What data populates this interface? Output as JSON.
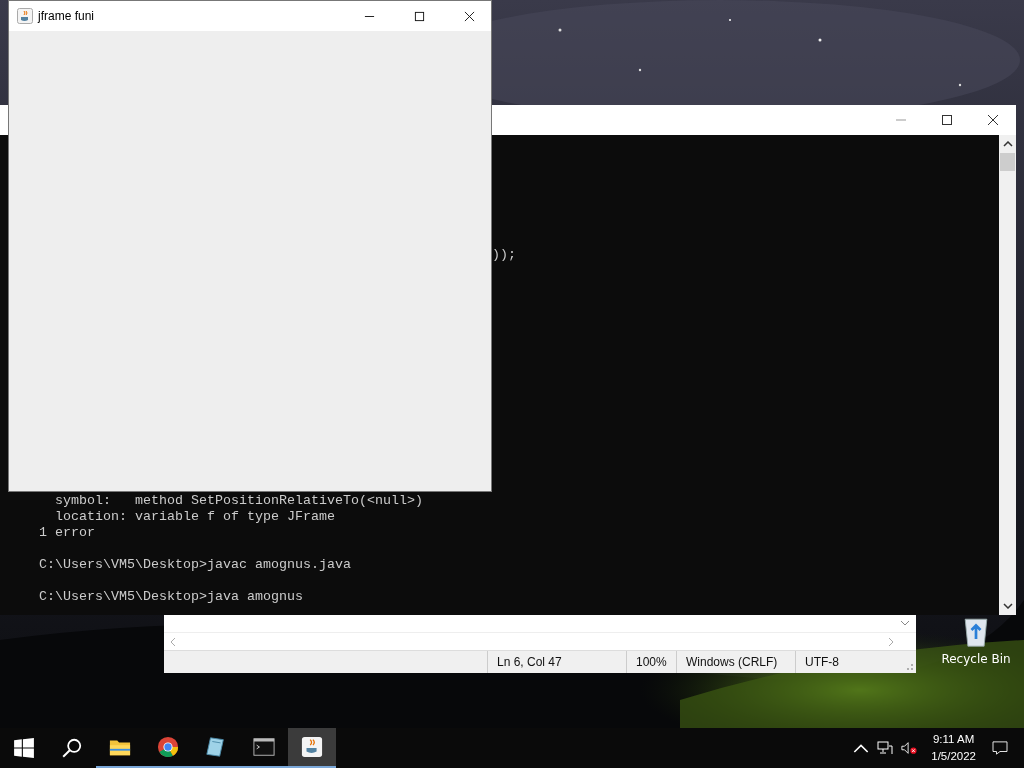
{
  "desktop": {
    "icons": [
      {
        "label": "Recycle Bin"
      }
    ]
  },
  "notepad": {
    "status_bar": [
      "Ln 6, Col 47",
      "100%",
      "Windows (CRLF)",
      "UTF-8"
    ]
  },
  "console": {
    "fragment": "));",
    "groups": [
      {
        "lines": [
          "  symbol:   method SetPositionRelativeTo(<null>)",
          "  location: variable f of type JFrame",
          "1 error"
        ]
      },
      {
        "lines": [
          "C:\\Users\\VM5\\Desktop>javac amognus.java"
        ]
      },
      {
        "lines": [
          "C:\\Users\\VM5\\Desktop>java amognus"
        ]
      }
    ]
  },
  "jframe": {
    "title": "jframe funi"
  },
  "taskbar": {
    "apps": [
      {
        "kind": "explorer",
        "running": true,
        "selected": false
      },
      {
        "kind": "chrome",
        "running": true,
        "selected": false
      },
      {
        "kind": "notepad",
        "running": true,
        "selected": false
      },
      {
        "kind": "terminal",
        "running": true,
        "selected": false
      },
      {
        "kind": "java",
        "running": true,
        "selected": true
      }
    ],
    "clock": {
      "time": "9:11 AM",
      "date": "1/5/2022"
    }
  }
}
